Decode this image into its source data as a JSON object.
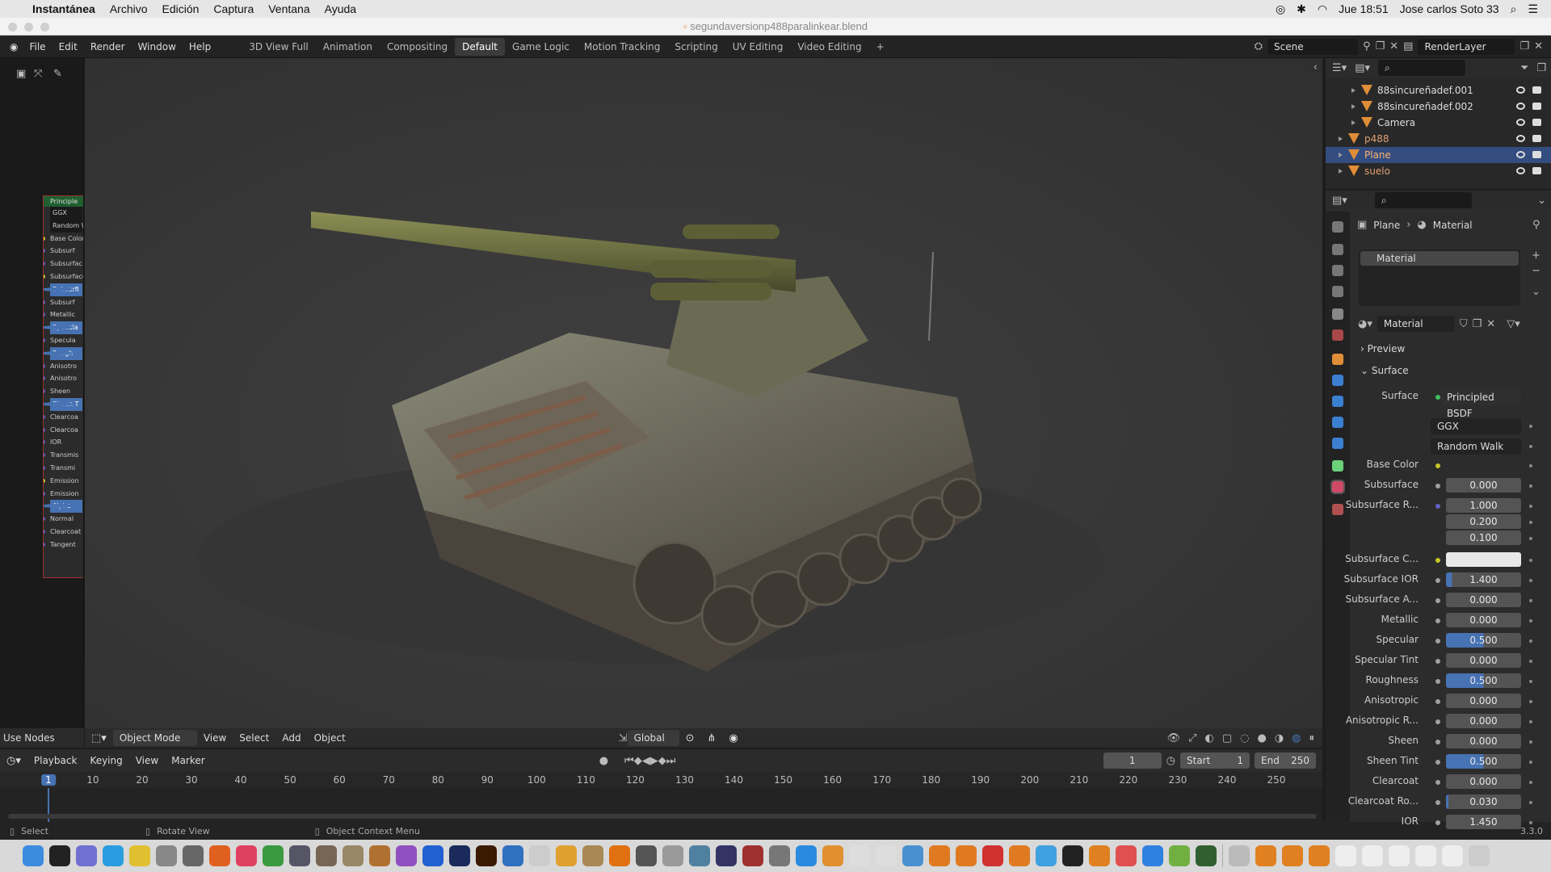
{
  "mac": {
    "app": "Instantánea",
    "menus": [
      "Archivo",
      "Edición",
      "Captura",
      "Ventana",
      "Ayuda"
    ],
    "clock": "Jue 18:51",
    "user": "Jose carlos Soto 33"
  },
  "window_title": "segundaversionp488paralinkear.blend",
  "blender_menus": [
    "File",
    "Edit",
    "Render",
    "Window",
    "Help"
  ],
  "workspaces": [
    "3D View Full",
    "Animation",
    "Compositing",
    "Default",
    "Game Logic",
    "Motion Tracking",
    "Scripting",
    "UV Editing",
    "Video Editing"
  ],
  "active_workspace": "Default",
  "scene": "Scene",
  "render_layer": "RenderLayer",
  "node_panel": {
    "title": "Principle",
    "rows": [
      {
        "label": "GGX",
        "type": "field"
      },
      {
        "label": "Random W",
        "type": "field"
      },
      {
        "label": "Base Color",
        "sock": "y"
      },
      {
        "label": "Subsurf",
        "sock": "p"
      },
      {
        "label": "Subsurfac",
        "sock": "p"
      },
      {
        "label": "Subsurface",
        "sock": "y"
      },
      {
        "label": "Subsurfi",
        "sock": "p",
        "hl": true
      },
      {
        "label": "Subsurf",
        "sock": "p"
      },
      {
        "label": "Metallic",
        "sock": "p"
      },
      {
        "label": "Specula",
        "sock": "p",
        "hl": true
      },
      {
        "label": "Specula",
        "sock": "p"
      },
      {
        "label": "Rough",
        "sock": "p",
        "hl": true
      },
      {
        "label": "Anisotro",
        "sock": "p"
      },
      {
        "label": "Anisotro",
        "sock": "p"
      },
      {
        "label": "Sheen",
        "sock": "p"
      },
      {
        "label": "Sheen T",
        "sock": "p",
        "hl": true
      },
      {
        "label": "Clearcoa",
        "sock": "p"
      },
      {
        "label": "Clearcoa",
        "sock": "p"
      },
      {
        "label": "IOR",
        "sock": "p"
      },
      {
        "label": "Transmis",
        "sock": "p"
      },
      {
        "label": "Transmi",
        "sock": "p"
      },
      {
        "label": "Emission",
        "sock": "y"
      },
      {
        "label": "Emission",
        "sock": "p"
      },
      {
        "label": "Alpha",
        "sock": "p",
        "hl": true
      },
      {
        "label": "Normal",
        "sock": "p"
      },
      {
        "label": "Clearcoat N",
        "sock": "p"
      },
      {
        "label": "Tangent",
        "sock": "p"
      }
    ]
  },
  "use_nodes": "Use Nodes",
  "viewport_header": {
    "mode": "Object Mode",
    "menus": [
      "View",
      "Select",
      "Add",
      "Object"
    ],
    "orientation": "Global"
  },
  "timeline": {
    "menus": [
      "Playback",
      "Keying",
      "View",
      "Marker"
    ],
    "current_frame": "1",
    "start_label": "Start",
    "start": "1",
    "end_label": "End",
    "end": "250",
    "ticks": [
      "1",
      "10",
      "20",
      "30",
      "40",
      "50",
      "60",
      "70",
      "80",
      "90",
      "100",
      "110",
      "120",
      "130",
      "140",
      "150",
      "160",
      "170",
      "180",
      "190",
      "200",
      "210",
      "220",
      "230",
      "240",
      "250"
    ]
  },
  "status": {
    "select": "Select",
    "rotate": "Rotate View",
    "context": "Object Context Menu",
    "version": "3.3.0"
  },
  "outliner": {
    "rows": [
      {
        "name": "88sincureñadef.001",
        "indent": 2
      },
      {
        "name": "88sincureñadef.002",
        "indent": 2
      },
      {
        "name": "Camera",
        "indent": 2,
        "camera": true
      },
      {
        "name": "p488",
        "indent": 1
      },
      {
        "name": "Plane",
        "indent": 1,
        "selected": true
      },
      {
        "name": "suelo",
        "indent": 1
      }
    ]
  },
  "properties": {
    "breadcrumb_object": "Plane",
    "breadcrumb_material": "Material",
    "slot": "Material",
    "material_name": "Material",
    "preview": "Preview",
    "surface_section": "Surface",
    "surface_label": "Surface",
    "surface_shader": "Principled BSDF",
    "distribution": "GGX",
    "subsurface_method": "Random Walk",
    "fields": [
      {
        "label": "Base Color",
        "dot": "y",
        "value": "",
        "color": "swatch-dark"
      },
      {
        "label": "Subsurface",
        "dot": "g",
        "value": "0.000",
        "fill": 0
      },
      {
        "label": "Subsurface R...",
        "dot": "p",
        "value": "1.000",
        "fill": 0
      },
      {
        "label": "",
        "dot": "",
        "value": "0.200",
        "fill": 0
      },
      {
        "label": "",
        "dot": "",
        "value": "0.100",
        "fill": 0
      },
      {
        "label": "Subsurface C...",
        "dot": "y",
        "value": "",
        "color": "swatch-white"
      },
      {
        "label": "Subsurface IOR",
        "dot": "g",
        "value": "1.400",
        "fill": 0.08
      },
      {
        "label": "Subsurface A...",
        "dot": "g",
        "value": "0.000",
        "fill": 0
      },
      {
        "label": "Metallic",
        "dot": "g",
        "value": "0.000",
        "fill": 0
      },
      {
        "label": "Specular",
        "dot": "g",
        "value": "0.500",
        "fill": 0.5
      },
      {
        "label": "Specular Tint",
        "dot": "g",
        "value": "0.000",
        "fill": 0
      },
      {
        "label": "Roughness",
        "dot": "g",
        "value": "0.500",
        "fill": 0.5
      },
      {
        "label": "Anisotropic",
        "dot": "g",
        "value": "0.000",
        "fill": 0
      },
      {
        "label": "Anisotropic R...",
        "dot": "g",
        "value": "0.000",
        "fill": 0
      },
      {
        "label": "Sheen",
        "dot": "g",
        "value": "0.000",
        "fill": 0
      },
      {
        "label": "Sheen Tint",
        "dot": "g",
        "value": "0.500",
        "fill": 0.5
      },
      {
        "label": "Clearcoat",
        "dot": "g",
        "value": "0.000",
        "fill": 0
      },
      {
        "label": "Clearcoat Ro...",
        "dot": "g",
        "value": "0.030",
        "fill": 0.03
      },
      {
        "label": "IOR",
        "dot": "g",
        "value": "1.450",
        "fill": 0
      }
    ]
  },
  "colors": {
    "accent": "#4772b3",
    "object_orange": "#e08d38",
    "selected_row": "#334d80",
    "mesh_green": "#6ad07a"
  }
}
